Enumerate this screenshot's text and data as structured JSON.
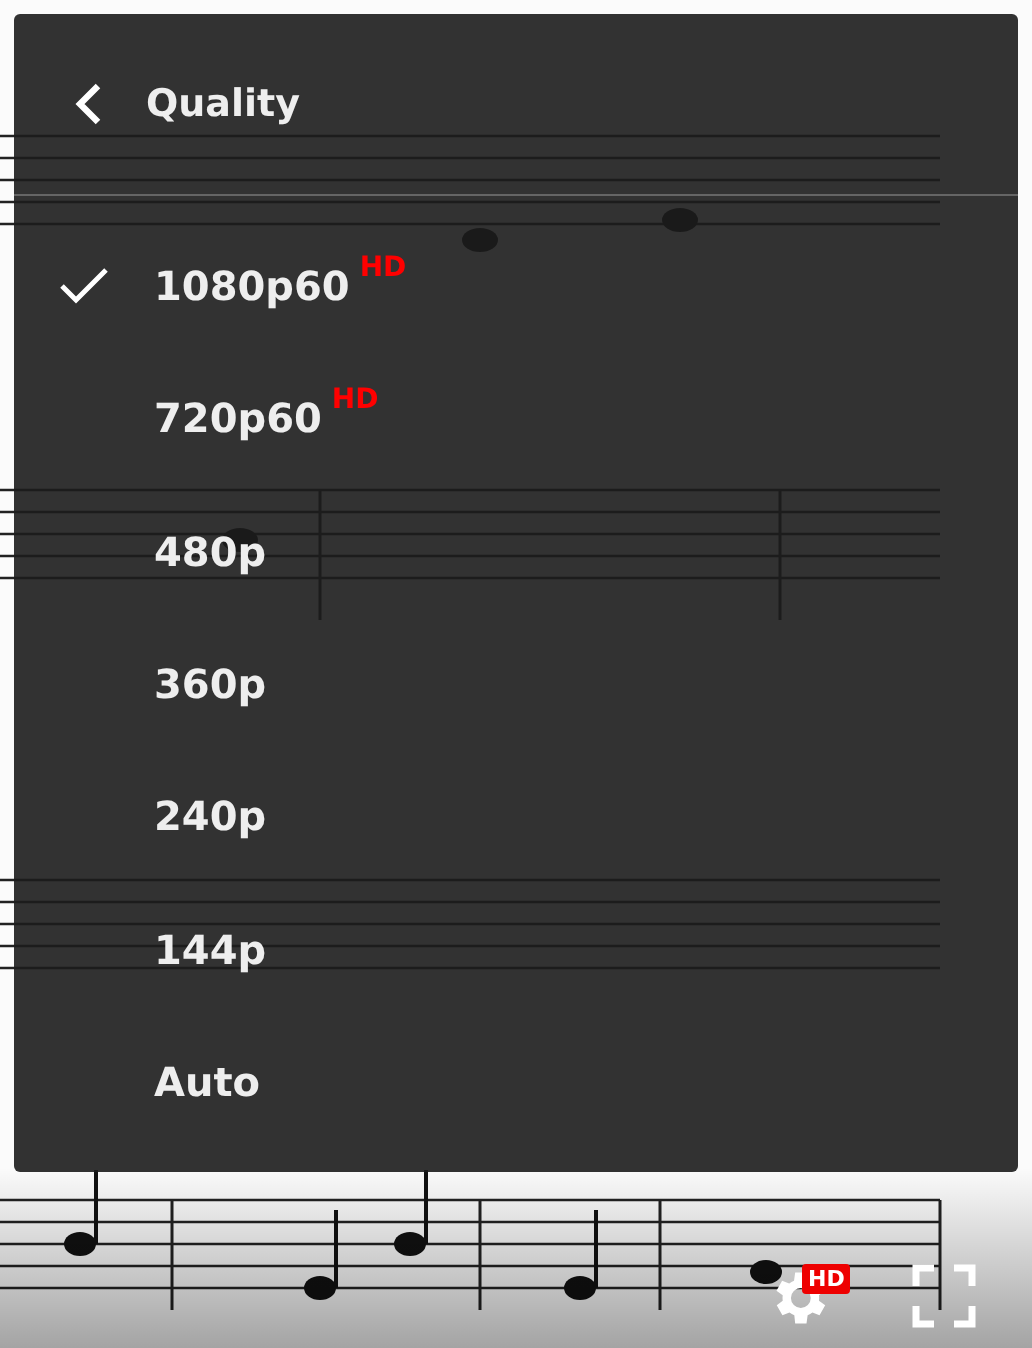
{
  "quality_menu": {
    "title": "Quality",
    "items": [
      {
        "label": "1080p60",
        "badge": "HD",
        "selected": true
      },
      {
        "label": "720p60",
        "badge": "HD",
        "selected": false
      },
      {
        "label": "480p",
        "selected": false
      },
      {
        "label": "360p",
        "selected": false
      },
      {
        "label": "240p",
        "selected": false
      },
      {
        "label": "144p",
        "selected": false
      },
      {
        "label": "Auto",
        "selected": false
      }
    ]
  },
  "controls": {
    "settings_badge": "HD"
  }
}
